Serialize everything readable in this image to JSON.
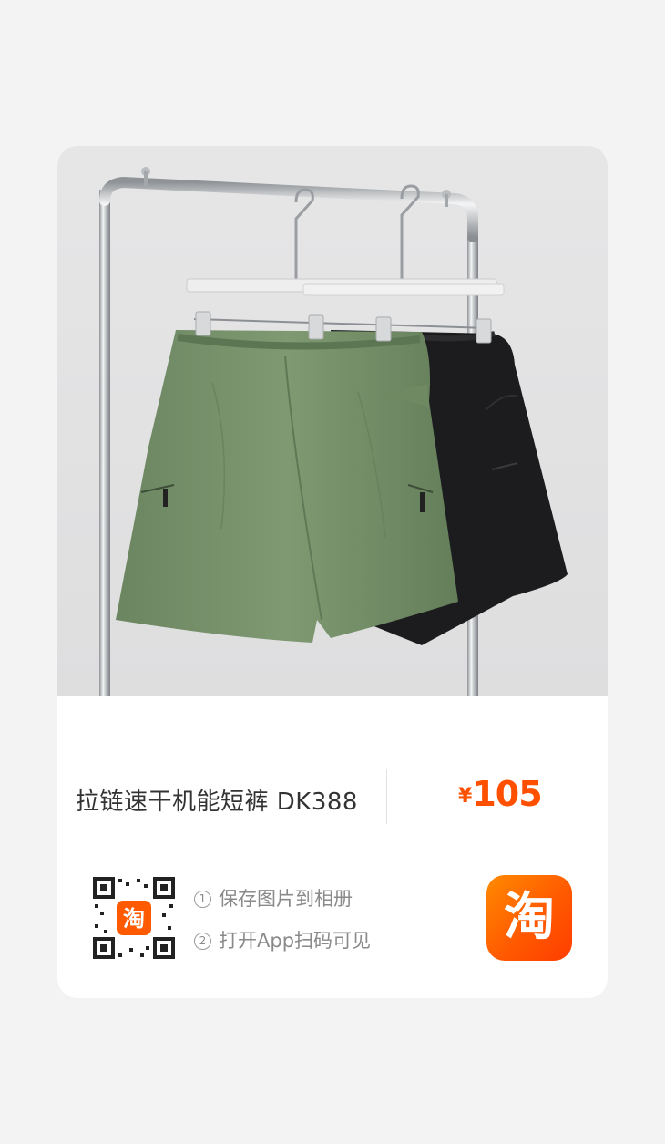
{
  "product": {
    "title": "拉链速干机能短裤 DK388",
    "price_symbol": "¥",
    "price_amount": "105",
    "image_alt": "two pairs of shorts (green and black) hanging on a chrome clothing rack"
  },
  "share": {
    "steps": [
      {
        "num": "1",
        "text": "保存图片到相册"
      },
      {
        "num": "2",
        "text": "打开App扫码可见"
      }
    ],
    "qr_center_logo": "淘",
    "app_logo_glyph": "淘"
  },
  "colors": {
    "price": "#ff5000",
    "brand_orange": "#ff5a00",
    "green_shorts": "#6f8a63",
    "black_shorts": "#1c1c1e"
  }
}
